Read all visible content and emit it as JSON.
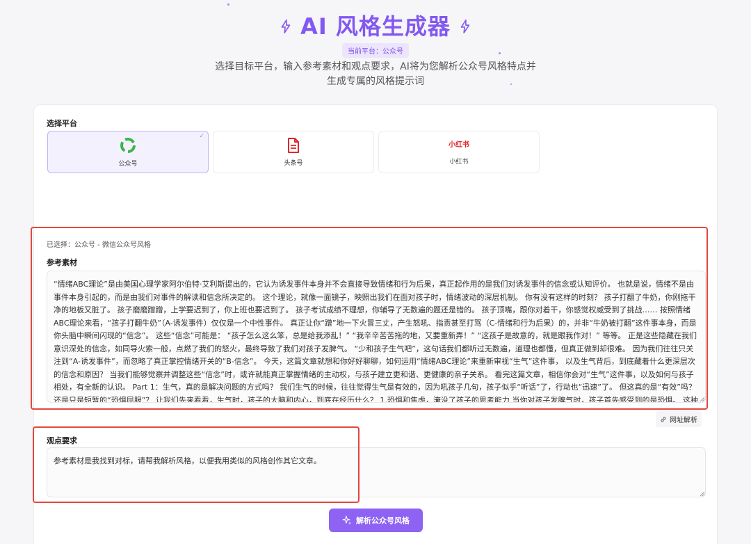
{
  "header": {
    "title": "AI 风格生成器",
    "platform_badge": "当前平台：公众号",
    "subtitle_line1": "选择目标平台，输入参考素材和观点要求，AI将为您解析公众号风格特点并",
    "subtitle_line2": "生成专属的风格提示词"
  },
  "platform_section": {
    "label": "选择平台",
    "platforms": [
      {
        "name": "公众号",
        "icon": "wechat-mp-icon",
        "selected": true,
        "color": "#3bb54a"
      },
      {
        "name": "头条号",
        "icon": "document-icon",
        "selected": false,
        "color": "#e0262b"
      },
      {
        "name": "小红书",
        "logo_text": "小红书",
        "selected": false,
        "color": "#e0262b"
      }
    ]
  },
  "selected_info": "已选择：公众号 - 微信公众号风格",
  "material": {
    "label": "参考素材",
    "value": "“情绪ABC理论”是由美国心理学家阿尔伯特·艾利斯提出的，它认为诱发事件本身并不会直接导致情绪和行为后果，真正起作用的是我们对诱发事件的信念或认知评价。 也就是说，情绪不是由事件本身引起的，而是由我们对事件的解读和信念所决定的。 这个理论，就像一面镜子，映照出我们在面对孩子时，情绪波动的深层机制。 你有没有这样的时刻？ 孩子打翻了牛奶，你刚拖干净的地板又脏了。 孩子磨磨蹭蹭，上学要迟到了，你上班也要迟到了。 孩子考试成绩不理想，你辅导了无数遍的题还是错的。 孩子顶嘴，跟你对着干，你感觉权威受到了挑战…… 按照情绪ABC理论来看，“孩子打翻牛奶”（A-诱发事件）仅仅是一个中性事件。 真正让你“蹭”地一下火冒三丈，产生怒吼、指责甚至打骂（C-情绪和行为后果）的，并非“牛奶被打翻”这件事本身，而是你头脑中瞬间闪现的“信念”。 这些“信念”可能是： “孩子怎么这么笨，总是给我添乱！” “我辛辛苦苦拖的地，又要重新弄！” “这孩子是故意的，就是跟我作对！” 等等。 正是这些隐藏在我们意识深处的信念，如同导火索一般，点燃了我们的怒火，最终导致了我们对孩子发脾气。 “少和孩子生气吧”，这句话我们都听过无数遍，道理也都懂，但真正做到却很难。 因为我们往往只关注到“A-诱发事件”，而忽略了真正掌控情绪开关的“B-信念”。 今天，这篇文章就想和你好好聊聊，如何运用“情绪ABC理论”来重新审视“生气”这件事， 以及生气背后，到底藏着什么更深层次的信念和原因？ 当我们能够觉察并调整这些“信念”时，或许就能真正掌握情绪的主动权，与孩子建立更和谐、更健康的亲子关系。 看完这篇文章，相信你会对“生气”这件事，以及如何与孩子相处，有全新的认识。 Part 1：生气，真的是解决问题的方式吗？ 我们生气的时候，往往觉得生气是有效的，因为吼孩子几句，孩子似乎“听话”了，行动也“迅速”了。 但这真的是“有效”吗？还是只是短暂的“恐惧屈服”？ 让我们先来看看，生气时，孩子的大脑和内心，到底在经历什么？ 1.恐惧和焦虑，淹没了孩子的思考能力 当你对孩子发脾气时，孩子首先感受到的是恐惧。 这种恐惧会激活孩子大脑中的“战斗或逃跑”反应，身体会分泌大量的压力激"
  },
  "url_parse_button": "网址解析",
  "viewpoint": {
    "label": "观点要求",
    "value": "参考素材是我找到对标，请帮我解析风格，以便我用类似的风格创作其它文章。"
  },
  "analyze_button": "解析公众号风格",
  "colors": {
    "accent": "#8358f0",
    "button": "#8e63f3",
    "highlight": "#e2483d"
  }
}
